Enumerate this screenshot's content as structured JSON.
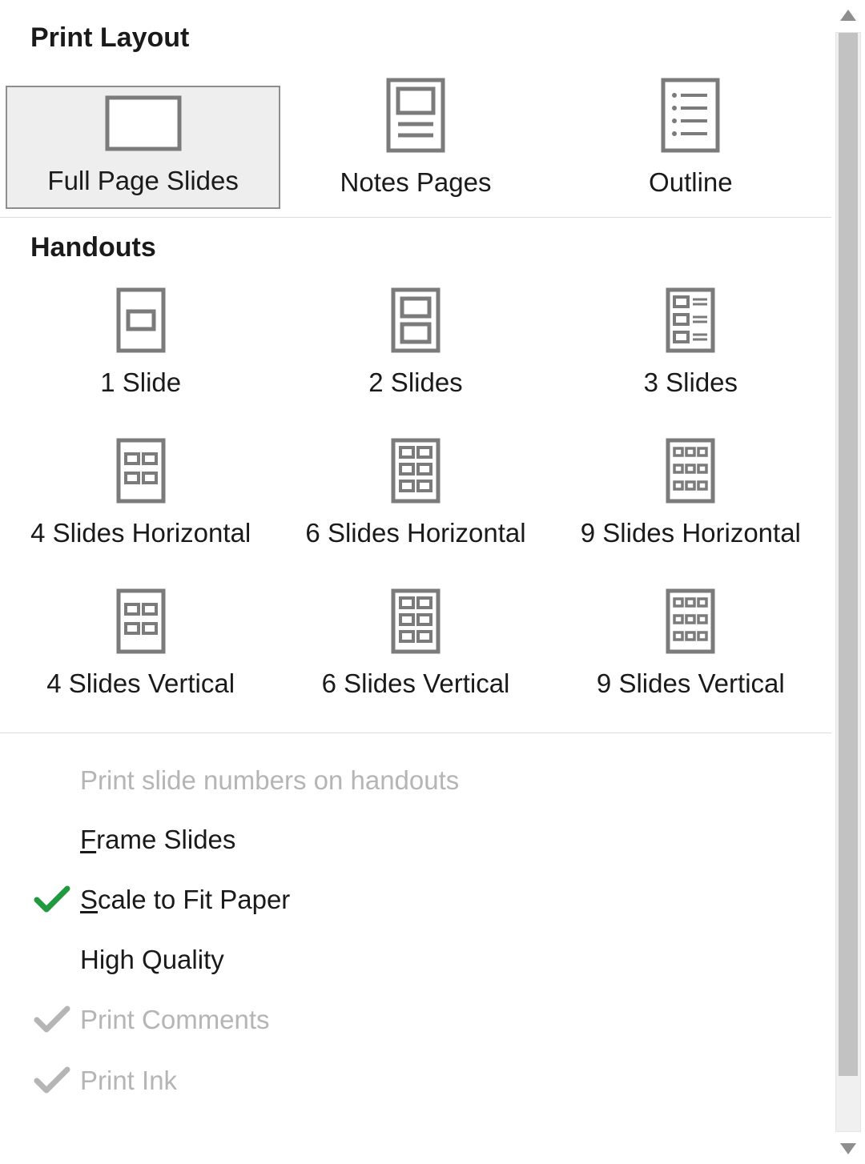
{
  "sections": {
    "print_layout_title": "Print Layout",
    "handouts_title": "Handouts"
  },
  "layout_options": {
    "full_page": "Full Page Slides",
    "notes": "Notes Pages",
    "outline": "Outline"
  },
  "handout_options": {
    "h1": "1 Slide",
    "h2": "2 Slides",
    "h3": "3 Slides",
    "h4h": "4 Slides Horizontal",
    "h6h": "6 Slides Horizontal",
    "h9h": "9 Slides Horizontal",
    "h4v": "4 Slides Vertical",
    "h6v": "6 Slides Vertical",
    "h9v": "9 Slides Vertical"
  },
  "checkbox_options": {
    "print_numbers": "Print slide numbers on handouts",
    "frame_slides_pre": "F",
    "frame_slides_rest": "rame Slides",
    "scale_pre": "S",
    "scale_rest": "cale to Fit Paper",
    "high_quality": "High Quality",
    "print_comments": "Print Comments",
    "print_ink": "Print Ink"
  },
  "state": {
    "selected_layout": "full_page",
    "scale_to_fit_checked": true
  },
  "colors": {
    "icon_stroke": "#7b7b7b",
    "check_green": "#1f9a3d",
    "check_gray": "#b5b5b5"
  }
}
